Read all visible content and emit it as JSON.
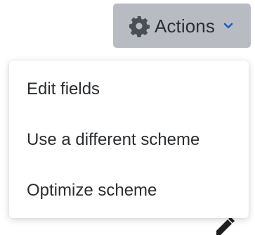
{
  "toolbar": {
    "actions_label": "Actions",
    "actions_icon": "gear-icon",
    "dropdown_indicator_icon": "chevron-down-icon",
    "button_color": "#b8bcc2",
    "chevron_color": "#1f5fbf"
  },
  "menu": {
    "items": [
      {
        "label": "Edit fields"
      },
      {
        "label": "Use a different scheme"
      },
      {
        "label": "Optimize scheme"
      }
    ]
  },
  "background": {
    "partial_icon": "pencil-icon"
  }
}
